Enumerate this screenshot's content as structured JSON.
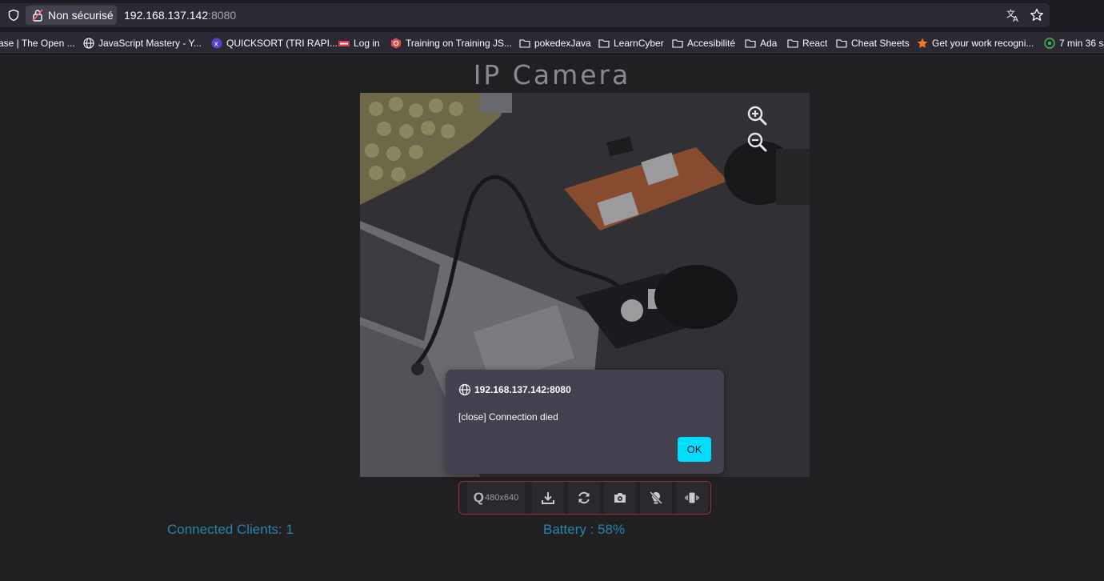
{
  "browser": {
    "security_label": "Non sécurisé",
    "url_host": "192.168.137.142",
    "url_port": ":8080"
  },
  "bookmarks": [
    {
      "label": "ase | The Open ...",
      "icon": "none"
    },
    {
      "label": "JavaScript Mastery - Y...",
      "icon": "globe-icon"
    },
    {
      "label": "QUICKSORT (TRI RAPI...",
      "icon": "site-favicon"
    },
    {
      "label": "Log in",
      "icon": "site-favicon"
    },
    {
      "label": "Training on Training JS...",
      "icon": "site-favicon"
    },
    {
      "label": "pokedexJava",
      "icon": "folder-icon"
    },
    {
      "label": "LearnCyber",
      "icon": "folder-icon"
    },
    {
      "label": "Accesibilité",
      "icon": "folder-icon"
    },
    {
      "label": "Ada",
      "icon": "folder-icon"
    },
    {
      "label": "React",
      "icon": "folder-icon"
    },
    {
      "label": "Cheat Sheets",
      "icon": "folder-icon"
    },
    {
      "label": "Get your work recogni...",
      "icon": "star-favicon"
    },
    {
      "label": "7 min 36 s",
      "icon": "site-favicon"
    }
  ],
  "page": {
    "title": "IP Camera",
    "connected_clients": "Connected Clients: 1",
    "battery": "Battery : 58%"
  },
  "dialog": {
    "origin": "192.168.137.142:8080",
    "message": "[close] Connection died",
    "ok_label": "OK"
  },
  "toolbar": {
    "quality_icon": "Q",
    "resolution": "480x640",
    "items": [
      "quality-selector",
      "download-icon",
      "refresh-icon",
      "switch-camera-icon",
      "flashlight-off-icon",
      "vibrate-icon"
    ]
  },
  "colors": {
    "background": "#202023",
    "status_text": "#2a84a3",
    "ok_button": "#00ddff",
    "toolbar_border": "#9b2c3a"
  }
}
